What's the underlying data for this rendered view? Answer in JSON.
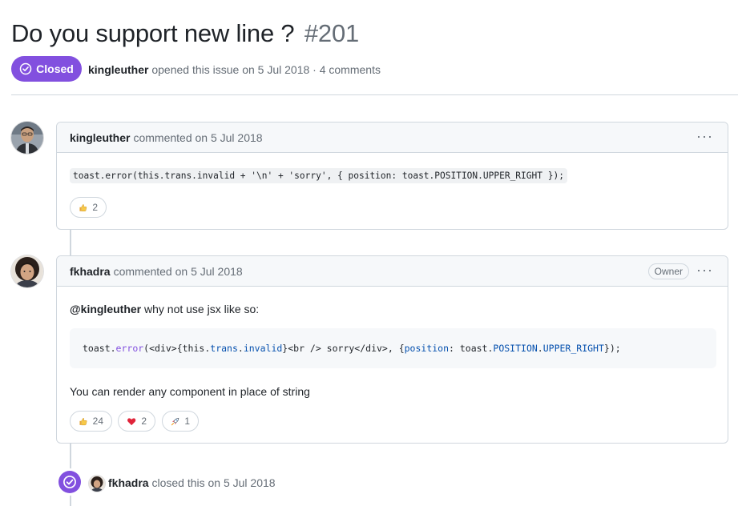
{
  "issue": {
    "title": "Do you support new line ?",
    "number": "#201",
    "state": "Closed",
    "author": "kingleuther",
    "opened_text": "opened this issue on 5 Jul 2018 · 4 comments"
  },
  "comments": [
    {
      "author": "kingleuther",
      "action": "commented on 5 Jul 2018",
      "code": "toast.error(this.trans.invalid + '\\n' + 'sorry', { position: toast.POSITION.UPPER_RIGHT });",
      "reactions": [
        {
          "emoji": "thumbs-up",
          "count": "2"
        }
      ]
    },
    {
      "author": "fkhadra",
      "action": "commented on 5 Jul 2018",
      "badge": "Owner",
      "mention": "@kingleuther",
      "intro_text": "why not use jsx like so:",
      "code": {
        "p1": "toast.",
        "p2": "error",
        "p3": "(<div>{this.",
        "p4": "trans",
        "p5": ".",
        "p6": "invalid",
        "p7": "}<br /> sorry</div>, { ",
        "p8": "position",
        "p9": ": toast.",
        "p10": "POSITION",
        "p11": ".",
        "p12": "UPPER_RIGHT",
        "p13": " });"
      },
      "outro_text": "You can render any component in place of string",
      "reactions": [
        {
          "emoji": "thumbs-up",
          "count": "24"
        },
        {
          "emoji": "heart",
          "count": "2"
        },
        {
          "emoji": "rocket",
          "count": "1"
        }
      ]
    }
  ],
  "event": {
    "author": "fkhadra",
    "text": "closed this on 5 Jul 2018"
  },
  "menu_glyph": "···",
  "colors": {
    "closed": "#8250df",
    "border": "#d0d7de",
    "muted": "#656d76",
    "header_bg": "#f6f8fa"
  }
}
